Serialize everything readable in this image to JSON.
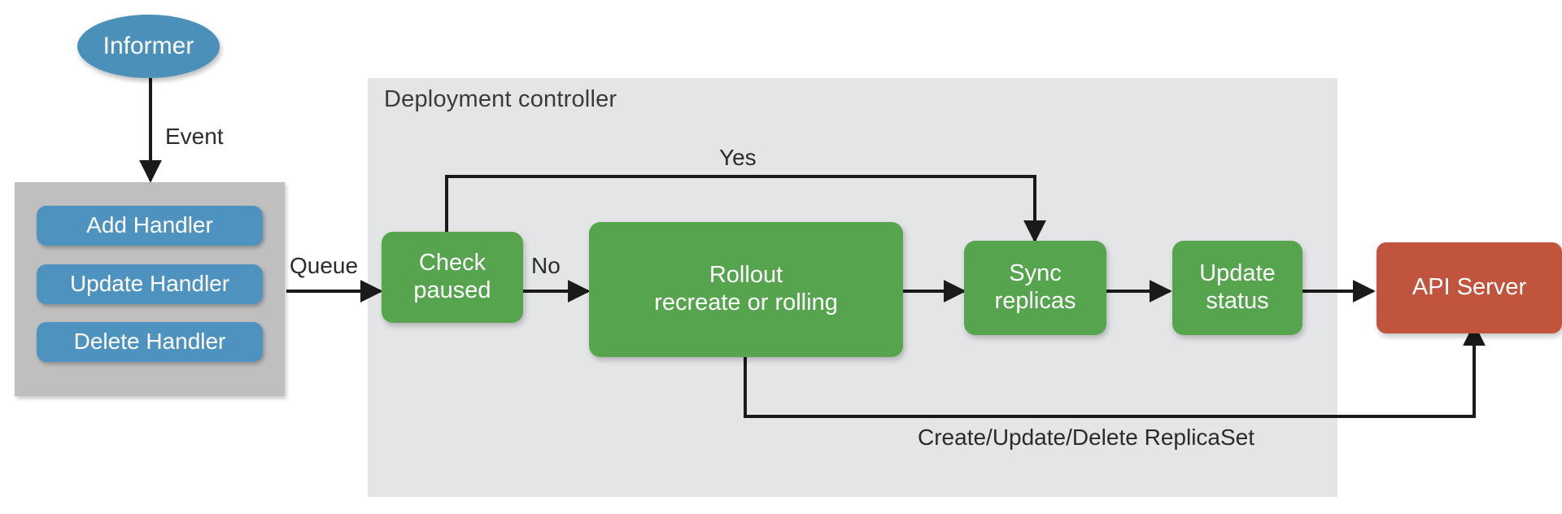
{
  "diagram": {
    "title_hidden": "Kubernetes Deployment controller flow"
  },
  "informer": {
    "label": "Informer"
  },
  "handlers_group": {
    "items": [
      {
        "label": "Add Handler"
      },
      {
        "label": "Update Handler"
      },
      {
        "label": "Delete Handler"
      }
    ]
  },
  "controller": {
    "title": "Deployment controller",
    "nodes": [
      {
        "id": "check-paused",
        "line1": "Check",
        "line2": "paused"
      },
      {
        "id": "rollout",
        "line1": "Rollout",
        "line2": "recreate or rolling"
      },
      {
        "id": "sync-replicas",
        "line1": "Sync",
        "line2": "replicas"
      },
      {
        "id": "update-status",
        "line1": "Update",
        "line2": "status"
      }
    ]
  },
  "api_server": {
    "label": "API Server"
  },
  "edge_labels": {
    "event": "Event",
    "queue": "Queue",
    "yes": "Yes",
    "no": "No",
    "replicaset": "Create/Update/Delete ReplicaSet"
  },
  "colors": {
    "informer_blue": "#4a90b9",
    "handler_blue": "#4e92bf",
    "handler_panel_gray": "#bfbfbf",
    "controller_panel_gray": "#e4e5e7",
    "green": "#56a44d",
    "red": "#c0543c",
    "edge_black": "#1a1a1a",
    "text_dark": "#2b2b2b"
  }
}
